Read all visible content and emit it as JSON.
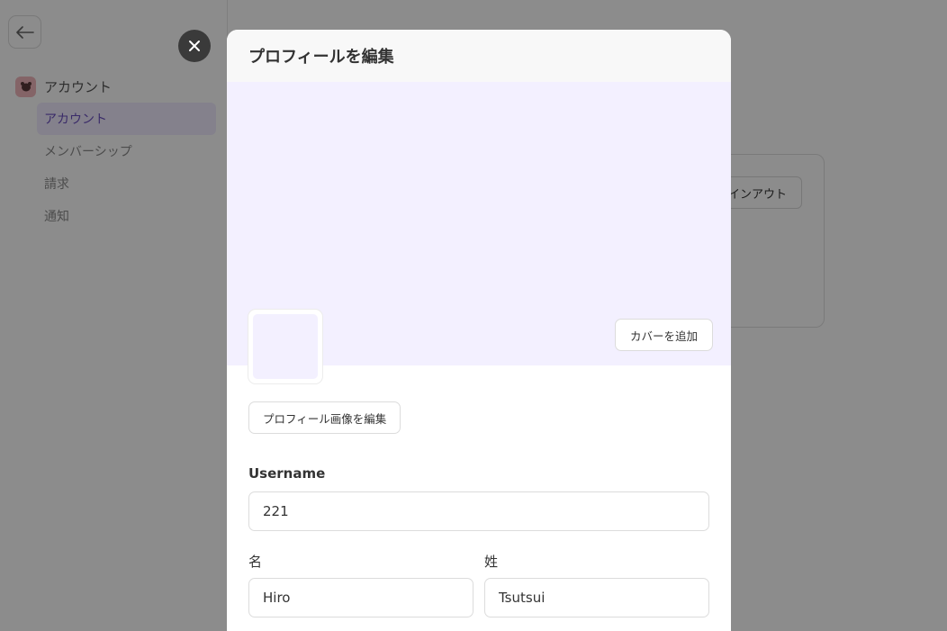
{
  "sidebar": {
    "section_label": "アカウント",
    "items": [
      {
        "label": "アカウント",
        "active": true
      },
      {
        "label": "メンバーシップ",
        "active": false
      },
      {
        "label": "請求",
        "active": false
      },
      {
        "label": "通知",
        "active": false
      }
    ]
  },
  "main": {
    "signout_label": "インアウト"
  },
  "modal": {
    "title": "プロフィールを編集",
    "add_cover_label": "カバーを追加",
    "edit_avatar_label": "プロフィール画像を編集",
    "username_label": "Username",
    "username_value": "221",
    "first_name_label": "名",
    "first_name_value": "Hiro",
    "last_name_label": "姓",
    "last_name_value": "Tsutsui"
  },
  "colors": {
    "accent": "#6b4fbf",
    "cover": "#f3f0ff",
    "avatar_icon_bg": "#f0b6bc"
  },
  "icons": {
    "back": "arrow-left-icon",
    "close": "close-icon",
    "account": "bear-icon"
  }
}
